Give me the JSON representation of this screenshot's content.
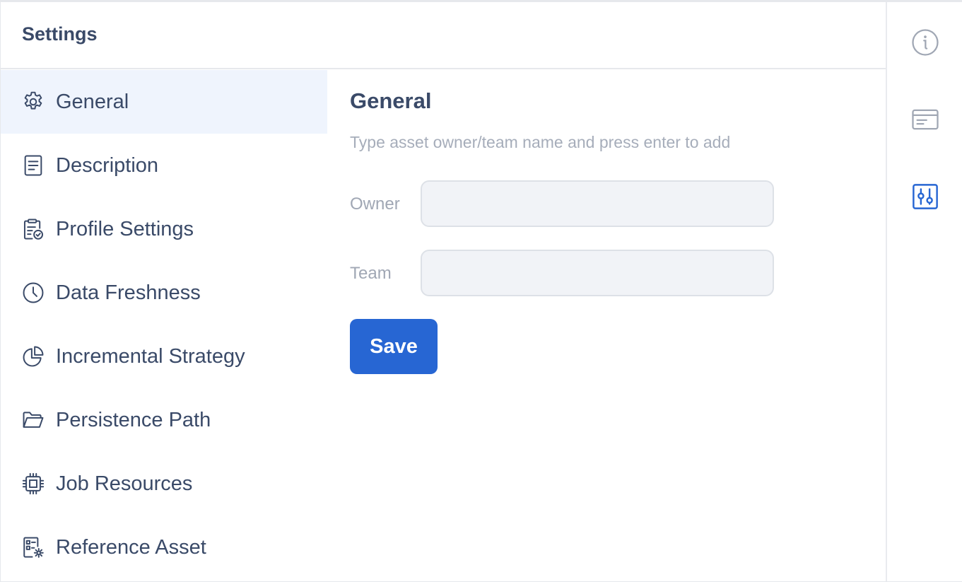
{
  "panel": {
    "title": "Settings"
  },
  "sidebar": {
    "items": [
      {
        "label": "General",
        "icon": "gear-icon",
        "active": true
      },
      {
        "label": "Description",
        "icon": "document-icon"
      },
      {
        "label": "Profile Settings",
        "icon": "clipboard-check-icon"
      },
      {
        "label": "Data Freshness",
        "icon": "clock-icon"
      },
      {
        "label": "Incremental Strategy",
        "icon": "pie-chart-icon"
      },
      {
        "label": "Persistence Path",
        "icon": "folder-open-icon"
      },
      {
        "label": "Job Resources",
        "icon": "cpu-chip-icon"
      },
      {
        "label": "Reference Asset",
        "icon": "file-settings-icon"
      }
    ]
  },
  "content": {
    "title": "General",
    "hint": "Type asset owner/team name and press enter to add",
    "owner": {
      "label": "Owner",
      "value": "",
      "placeholder": ""
    },
    "team": {
      "label": "Team",
      "value": "",
      "placeholder": ""
    },
    "save_label": "Save"
  },
  "rail": {
    "items": [
      {
        "icon": "info-icon"
      },
      {
        "icon": "card-icon"
      },
      {
        "icon": "sliders-icon",
        "active": true
      }
    ]
  },
  "colors": {
    "accent": "#2766d3",
    "active_bg": "#eff4fd",
    "text": "#3a4a68",
    "muted": "#a6adba",
    "input_bg": "#f1f3f7",
    "rail_icon": "#a0a7b4"
  }
}
